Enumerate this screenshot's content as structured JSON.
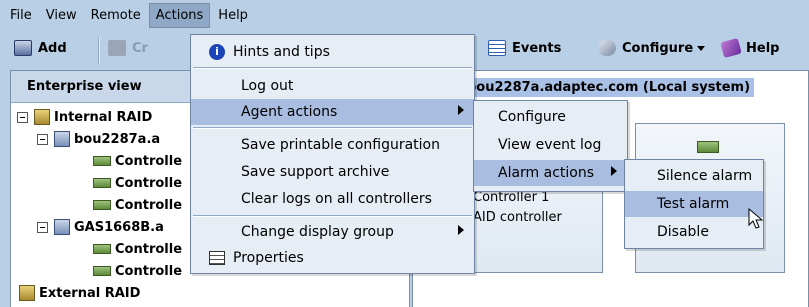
{
  "menubar": {
    "file": "File",
    "view": "View",
    "remote": "Remote",
    "actions": "Actions",
    "help": "Help"
  },
  "toolbar": {
    "add": "Add",
    "create_partial": "Cr",
    "events": "Events",
    "configure": "Configure",
    "help": "Help"
  },
  "left_panel": {
    "title": "Enterprise view",
    "tree": [
      {
        "label": "Internal RAID",
        "level": 0
      },
      {
        "label": "bou2287a.a",
        "level": 1
      },
      {
        "label": "Controlle",
        "level": 2
      },
      {
        "label": "Controlle",
        "level": 2
      },
      {
        "label": "Controlle",
        "level": 2
      },
      {
        "label": "GAS1668B.a",
        "level": 1
      },
      {
        "label": "Controlle",
        "level": 2
      },
      {
        "label": "Controlle",
        "level": 2
      },
      {
        "label": "External RAID",
        "level": 0
      }
    ]
  },
  "right_panel": {
    "title": "bou2287a.adaptec.com (Local system)",
    "card1_line1": "Controller 1",
    "card1_line2": "AID controller"
  },
  "actions_menu": {
    "items": [
      {
        "label": "Hints and tips"
      },
      {
        "label": "Log out"
      },
      {
        "label": "Agent actions"
      },
      {
        "label": "Save printable configuration"
      },
      {
        "label": "Save support archive"
      },
      {
        "label": "Clear logs on all controllers"
      },
      {
        "label": "Change display group"
      },
      {
        "label": "Properties"
      }
    ]
  },
  "agent_menu": {
    "items": [
      {
        "label": "Configure"
      },
      {
        "label": "View event log"
      },
      {
        "label": "Alarm actions"
      }
    ]
  },
  "alarm_menu": {
    "items": [
      {
        "label": "Silence alarm"
      },
      {
        "label": "Test alarm"
      },
      {
        "label": "Disable"
      }
    ]
  },
  "colors": {
    "background": "#b8cfe5",
    "highlight": "#a9bde0",
    "menu_bg": "#e6edf5"
  }
}
